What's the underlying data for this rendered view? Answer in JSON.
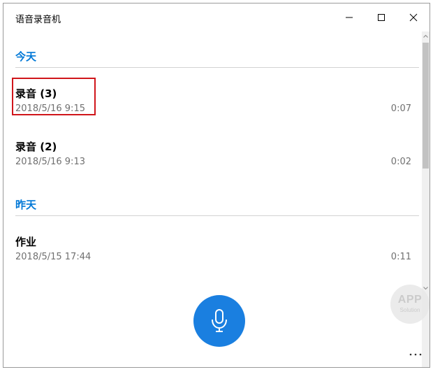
{
  "window": {
    "title": "语音录音机"
  },
  "sections": [
    {
      "header": "今天",
      "recordings": [
        {
          "name": "录音 (3)",
          "date": "2018/5/16 9:15",
          "duration": "0:07"
        },
        {
          "name": "录音 (2)",
          "date": "2018/5/16 9:13",
          "duration": "0:02"
        }
      ]
    },
    {
      "header": "昨天",
      "recordings": [
        {
          "name": "作业",
          "date": "2018/5/15 17:44",
          "duration": "0:11"
        }
      ]
    }
  ],
  "icons": {
    "minimize": "minimize-icon",
    "maximize": "maximize-icon",
    "close": "close-icon",
    "record": "microphone-icon",
    "more": "more-icon"
  },
  "watermark": {
    "line1": "APP",
    "line2": "Solution"
  },
  "colors": {
    "accent": "#0078d7",
    "record_button": "#1a7fe0",
    "highlight": "#d0161b"
  }
}
